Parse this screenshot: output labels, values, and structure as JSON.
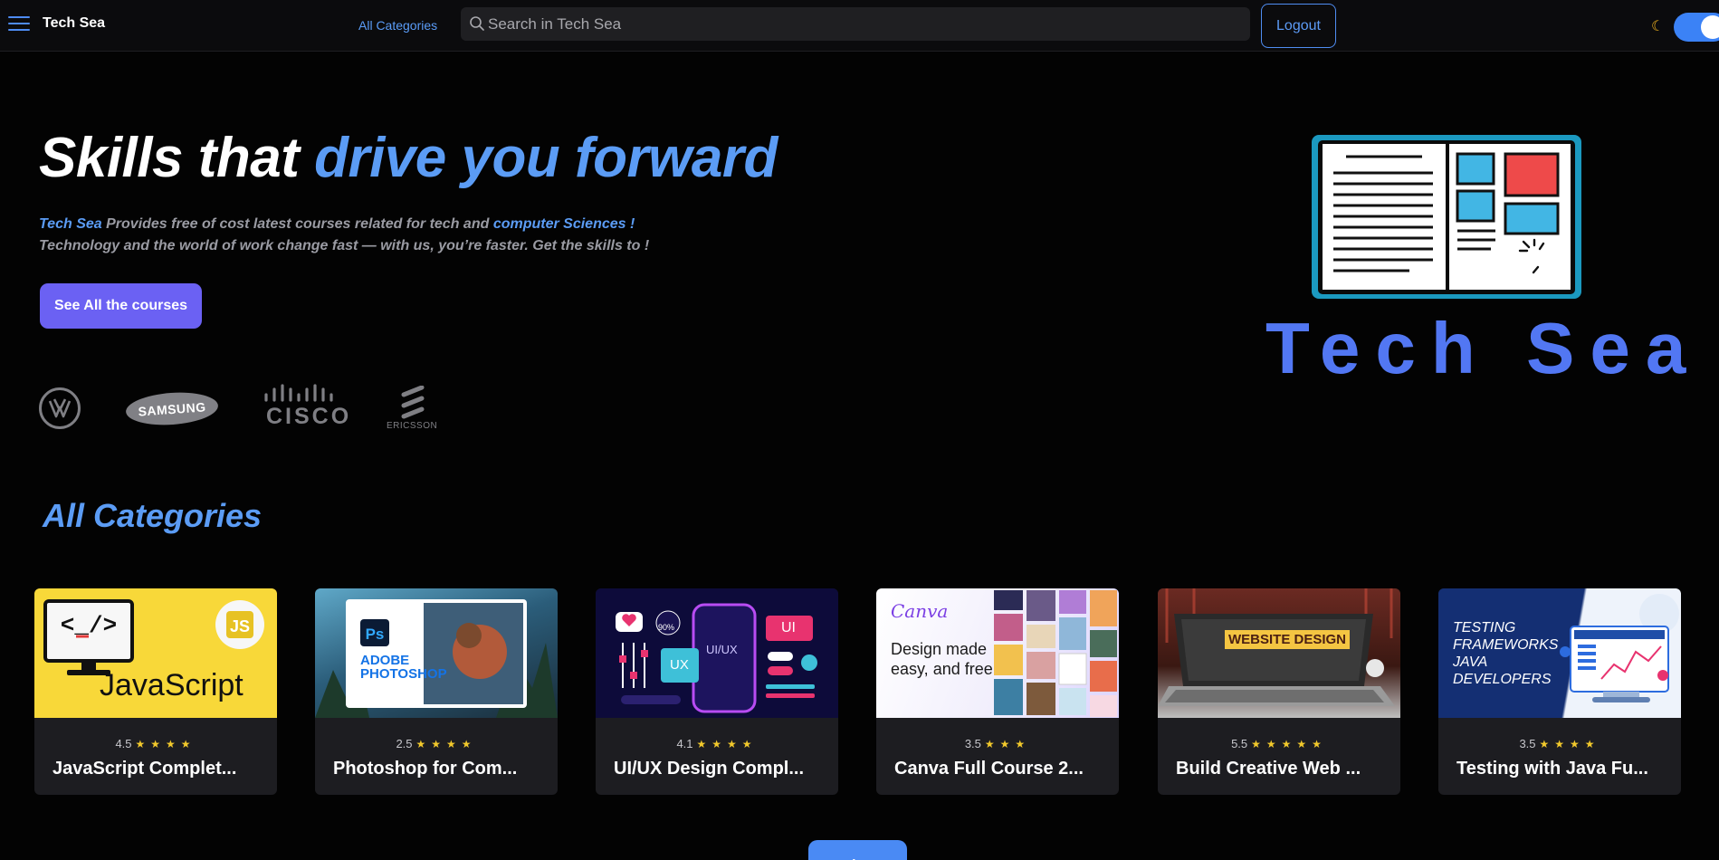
{
  "header": {
    "brand": "Tech Sea",
    "categories_link": "All Categories",
    "search_placeholder": "Search in Tech Sea",
    "logout_label": "Logout",
    "theme_toggle_on": true,
    "accent": "#4f8df2"
  },
  "hero": {
    "title_plain": "Skills that ",
    "title_accent": "drive you forward",
    "desc_line1_brand": "Tech Sea",
    "desc_line1_mid": " Provides free of cost latest courses related for tech and ",
    "desc_line1_accent": "computer Sciences !",
    "desc_line2": "Technology and the world of work change fast — with us, you’re faster. Get the skills to !",
    "cta_label": "See All the courses",
    "partner_logos": [
      "SAMSUNG",
      "CISCO",
      "ERICSSON"
    ],
    "illustration_wordmark": "Tech Sea"
  },
  "categories": {
    "title": "All Categories",
    "cards": [
      {
        "rating": "4.5",
        "stars": "★★★★",
        "title": "JavaScript Complet...",
        "thumb_text": "JavaScript"
      },
      {
        "rating": "2.5",
        "stars": "★★★★",
        "title": "Photoshop for Com...",
        "thumb_text": "ADOBE PHOTOSHOP"
      },
      {
        "rating": "4.1",
        "stars": "★★★★",
        "title": "UI/UX Design Compl...",
        "thumb_text": "UI/UX"
      },
      {
        "rating": "3.5",
        "stars": "★★★",
        "title": "Canva Full Course 2...",
        "thumb_text": "Design made easy, and free"
      },
      {
        "rating": "5.5",
        "stars": "★★★★★",
        "title": "Build Creative Web ...",
        "thumb_text": "WEBSITE DESIGN"
      },
      {
        "rating": "3.5",
        "stars": "★★★★",
        "title": "Testing with Java Fu...",
        "thumb_text": "TESTING FRAMEWORKS JAVA DEVELOPERS"
      }
    ],
    "load_more_label": "Load More"
  }
}
